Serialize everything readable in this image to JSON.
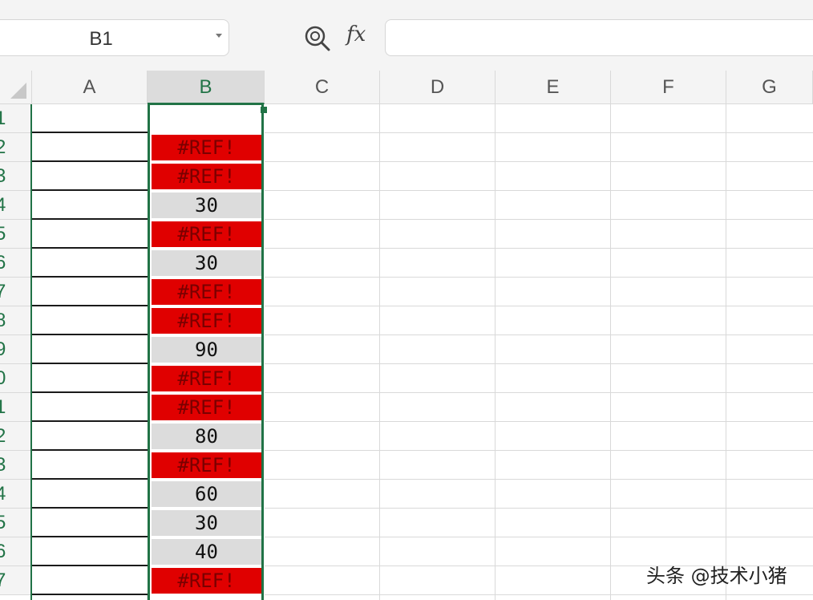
{
  "formula_bar": {
    "name_box_value": "B1",
    "zoom_icon": "zoom-search-icon",
    "fx_label": "fx",
    "formula_value": ""
  },
  "columns": [
    "A",
    "B",
    "C",
    "D",
    "E",
    "F",
    "G"
  ],
  "selected_column": "B",
  "rows": [
    "1",
    "2",
    "3",
    "4",
    "5",
    "6",
    "7",
    "8",
    "9",
    "0",
    "1",
    "2",
    "3",
    "4",
    "5",
    "6",
    "7"
  ],
  "column_b": [
    {
      "value": "",
      "kind": "blank"
    },
    {
      "value": "#REF!",
      "kind": "err"
    },
    {
      "value": "#REF!",
      "kind": "err"
    },
    {
      "value": "30",
      "kind": "num"
    },
    {
      "value": "#REF!",
      "kind": "err"
    },
    {
      "value": "30",
      "kind": "num"
    },
    {
      "value": "#REF!",
      "kind": "err"
    },
    {
      "value": "#REF!",
      "kind": "err"
    },
    {
      "value": "90",
      "kind": "num"
    },
    {
      "value": "#REF!",
      "kind": "err"
    },
    {
      "value": "#REF!",
      "kind": "err"
    },
    {
      "value": "80",
      "kind": "num"
    },
    {
      "value": "#REF!",
      "kind": "err"
    },
    {
      "value": "60",
      "kind": "num"
    },
    {
      "value": "30",
      "kind": "num"
    },
    {
      "value": "40",
      "kind": "num"
    },
    {
      "value": "#REF!",
      "kind": "err"
    }
  ],
  "colors": {
    "accent_green": "#217346",
    "error_fill": "#e00000",
    "value_fill": "#dcdcdc"
  },
  "watermark": "头条 @技术小猪"
}
